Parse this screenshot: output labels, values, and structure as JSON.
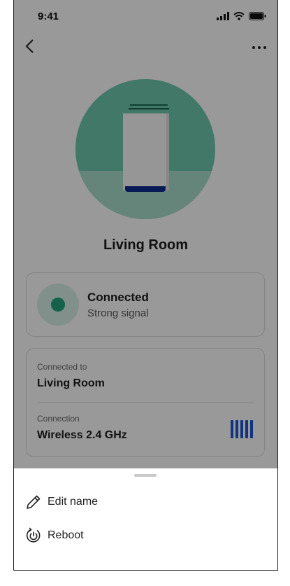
{
  "status_bar": {
    "time": "9:41"
  },
  "nav": {
    "back_icon": "chevron-left-icon",
    "more_icon": "more-horizontal-icon"
  },
  "device": {
    "name": "Living Room",
    "hero_color": "#6fc9ad"
  },
  "status_card": {
    "title": "Connected",
    "subtitle": "Strong signal",
    "dot_color": "#21a47a"
  },
  "info_card": {
    "connected_to_label": "Connected to",
    "connected_to_value": "Living Room",
    "connection_label": "Connection",
    "connection_value": "Wireless 2.4 GHz",
    "signal_bars": 5,
    "signal_color": "#1f55d6"
  },
  "bottom_sheet": {
    "items": [
      {
        "label": "Edit name",
        "icon": "pencil-icon"
      },
      {
        "label": "Reboot",
        "icon": "power-refresh-icon"
      }
    ]
  }
}
